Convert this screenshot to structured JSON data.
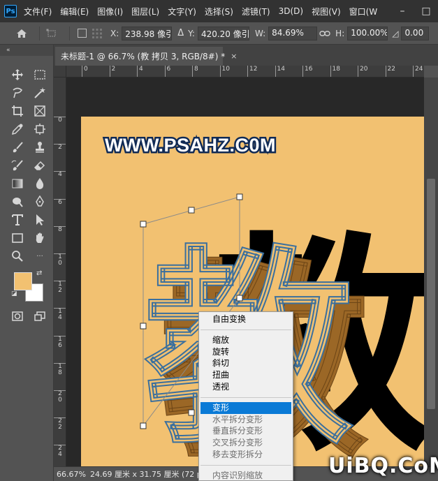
{
  "menubar": {
    "logo": "Ps",
    "items": [
      "文件(F)",
      "编辑(E)",
      "图像(I)",
      "图层(L)",
      "文字(Y)",
      "选择(S)",
      "滤镜(T)",
      "3D(D)",
      "视图(V)",
      "窗口(W"
    ],
    "window_controls": [
      "–",
      "□"
    ]
  },
  "options": {
    "x_label": "X:",
    "x_value": "238.98 像引",
    "delta": "Δ",
    "y_label": "Y:",
    "y_value": "420.20 像引",
    "w_label": "W:",
    "w_value": "84.69%",
    "h_label": "H:",
    "h_value": "100.00%",
    "angle_value": "0.00"
  },
  "toolbar": {
    "collapse": "«",
    "fg_color": "#f2c171",
    "bg_color": "#ffffff"
  },
  "document": {
    "tab_title": "未标题-1 @ 66.7% (教 拷贝 3, RGB/8#) *",
    "tab_close": "×"
  },
  "rulers": {
    "h_labels": [
      "0",
      "2",
      "4",
      "6",
      "8",
      "10",
      "12",
      "14",
      "16",
      "18",
      "20",
      "22",
      "24"
    ],
    "v_labels": [
      "0",
      "2",
      "4",
      "6",
      "8",
      "1 0",
      "1 2",
      "1 4",
      "1 6",
      "1 8",
      "2 0",
      "2 2",
      "2 4"
    ]
  },
  "canvas": {
    "header_text": "WWW.PSAHZ.C0M",
    "glyph": "教",
    "background_color": "#f2c171",
    "shadow_color": "#9b6726"
  },
  "status": {
    "zoom": "66.67%",
    "size": "24.69 厘米 x 31.75 厘米 (72 pp"
  },
  "context_menu": {
    "items": [
      {
        "label": "自由变换",
        "state": "normal"
      },
      {
        "sep": true
      },
      {
        "label": "缩放",
        "state": "normal"
      },
      {
        "label": "旋转",
        "state": "normal"
      },
      {
        "label": "斜切",
        "state": "normal"
      },
      {
        "label": "扭曲",
        "state": "normal"
      },
      {
        "label": "透视",
        "state": "normal"
      },
      {
        "sep": true
      },
      {
        "label": "变形",
        "state": "selected"
      },
      {
        "label": "水平拆分变形",
        "state": "disabled"
      },
      {
        "label": "垂直拆分变形",
        "state": "disabled"
      },
      {
        "label": "交叉拆分变形",
        "state": "disabled"
      },
      {
        "label": "移去变形拆分",
        "state": "disabled"
      },
      {
        "sep": true
      },
      {
        "label": "内容识别缩放",
        "state": "disabled"
      },
      {
        "label": "操控变形",
        "state": "disabled"
      }
    ]
  },
  "watermark": "UiBQ.CoM"
}
